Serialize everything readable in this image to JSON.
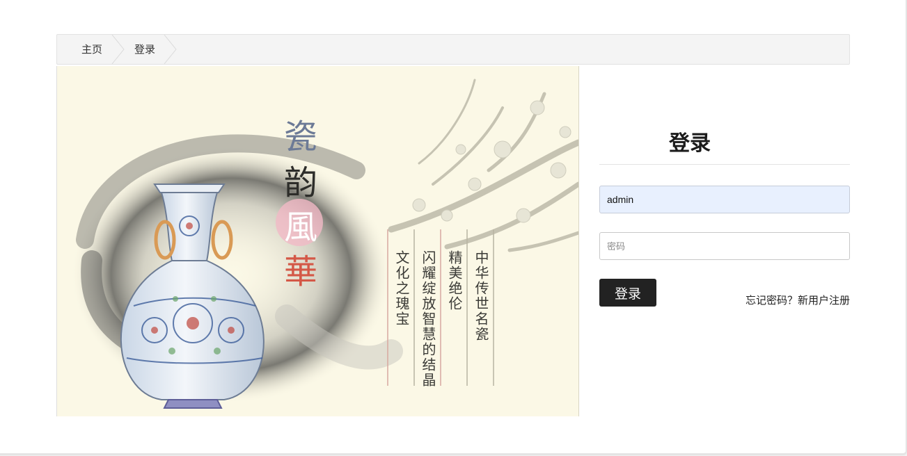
{
  "breadcrumb": {
    "home": "主页",
    "current": "登录"
  },
  "hero": {
    "title_chars": [
      "瓷",
      "韵",
      "風",
      "華"
    ],
    "poem_lines": [
      "中华传世名瓷",
      "精美绝伦",
      "闪耀绽放智慧的结晶",
      "文化之瑰宝"
    ]
  },
  "login": {
    "title": "登录",
    "username_value": "admin",
    "password_placeholder": "密码",
    "submit_label": "登录",
    "forgot_link": "忘记密码？",
    "register_link": "新用户注册"
  },
  "colors": {
    "accent": "#222222",
    "autofill": "#e8f0fe",
    "hero_bg": "#fbf8e6"
  }
}
